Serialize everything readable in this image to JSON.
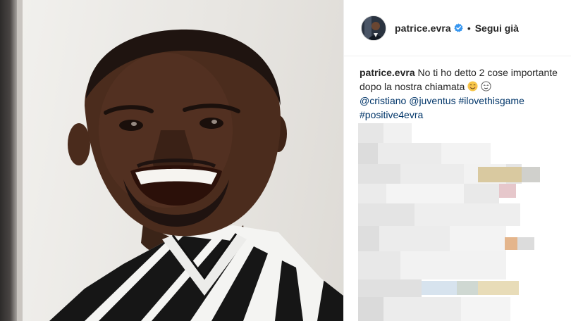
{
  "header": {
    "username": "patrice.evra",
    "separator": "•",
    "follow_label": "Segui già"
  },
  "caption": {
    "username": "patrice.evra",
    "text": "No ti ho detto 2 cose importante dopo la nostra chiamata",
    "tags": [
      "@cristiano",
      "@juventus",
      "#ilovethisgame",
      "#positive4evra"
    ]
  },
  "colors": {
    "text": "#262626",
    "link": "#003569",
    "verified": "#3897f0",
    "border": "#efefef"
  },
  "icons": {
    "verified": "verified-badge-icon",
    "emoji_1": "smiling-face-emoji-icon",
    "emoji_2": "relieved-face-emoji-icon"
  }
}
